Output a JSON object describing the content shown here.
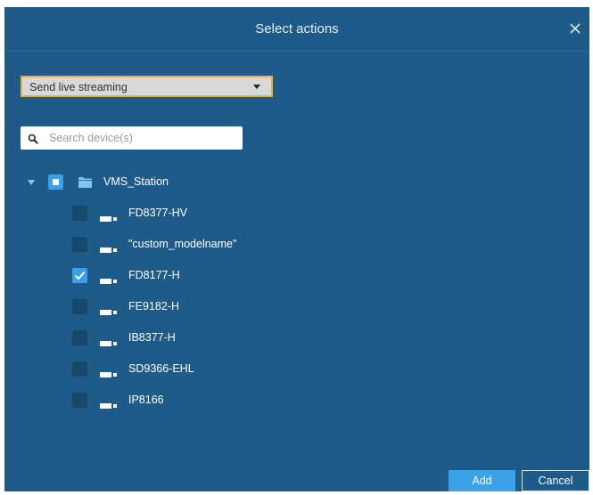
{
  "dialog": {
    "title": "Select actions",
    "close_icon": "close-icon"
  },
  "action_select": {
    "selected": "Send live streaming"
  },
  "search": {
    "placeholder": "Search device(s)",
    "value": ""
  },
  "tree": {
    "root": {
      "label": "VMS_Station",
      "expanded": true,
      "check_state": "partial",
      "icon": "folder-icon"
    },
    "devices": [
      {
        "label": "FD8377-HV",
        "checked": false,
        "icon": "camera-icon"
      },
      {
        "label": "\"custom_modelname\"",
        "checked": false,
        "icon": "camera-icon"
      },
      {
        "label": "FD8177-H",
        "checked": true,
        "icon": "camera-icon"
      },
      {
        "label": "FE9182-H",
        "checked": false,
        "icon": "camera-icon"
      },
      {
        "label": "IB8377-H",
        "checked": false,
        "icon": "camera-icon"
      },
      {
        "label": "SD9366-EHL",
        "checked": false,
        "icon": "camera-icon"
      },
      {
        "label": "IP8166",
        "checked": false,
        "icon": "camera-icon"
      }
    ]
  },
  "footer": {
    "add_label": "Add",
    "cancel_label": "Cancel"
  },
  "colors": {
    "background": "#1e5b88",
    "accent": "#3aa0e8",
    "dropdown_border": "#e2b23a"
  }
}
